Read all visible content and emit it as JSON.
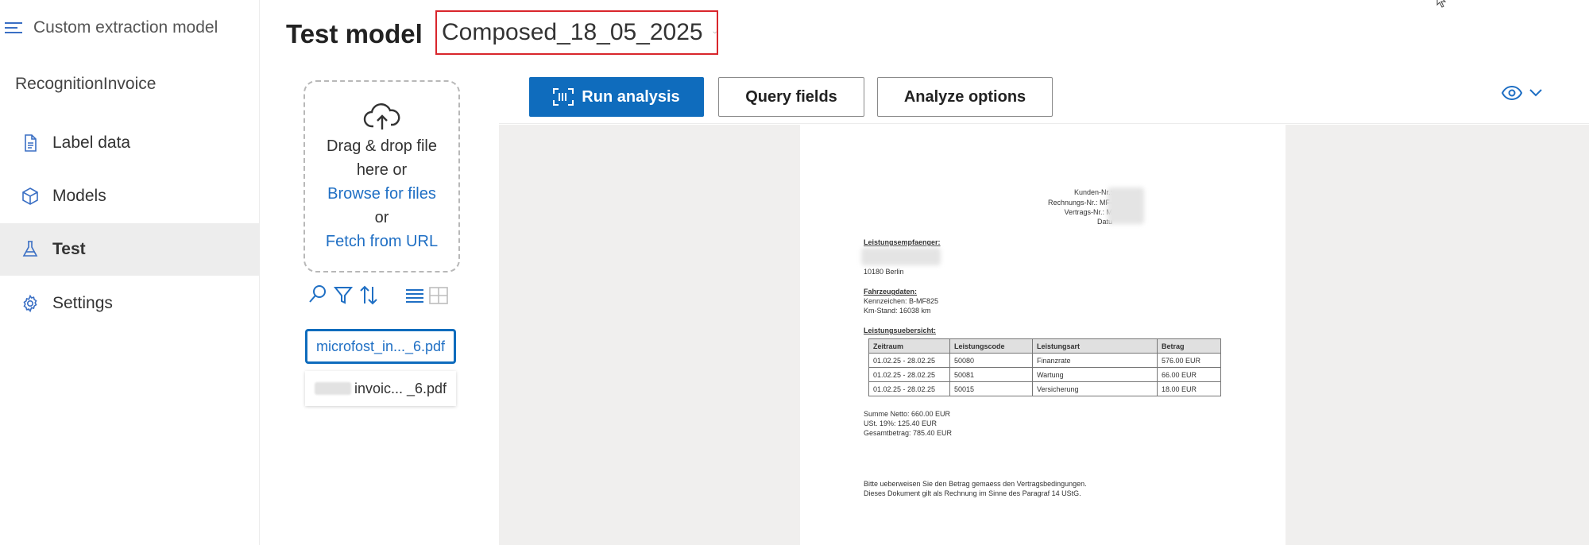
{
  "sidebar": {
    "app_title": "Custom extraction model",
    "project_name": "RecognitionInvoice",
    "items": [
      {
        "label": "Label data",
        "icon": "document-icon"
      },
      {
        "label": "Models",
        "icon": "cube-icon"
      },
      {
        "label": "Test",
        "icon": "flask-icon",
        "active": true
      },
      {
        "label": "Settings",
        "icon": "gear-icon"
      }
    ]
  },
  "header": {
    "title": "Test model",
    "selected_model": "Composed_18_05_2025"
  },
  "upload": {
    "line1": "Drag & drop file",
    "line2": "here or",
    "browse": "Browse for files",
    "or": "or",
    "fetch": "Fetch from URL"
  },
  "files": [
    {
      "name": "microfost_in..._6.pdf",
      "selected": true
    },
    {
      "name_visible": "invoic... _6.pdf",
      "selected": false
    }
  ],
  "toolbar": {
    "run_label": "Run analysis",
    "query_label": "Query fields",
    "options_label": "Analyze options"
  },
  "document": {
    "header_fields": [
      "Kunden-Nr.:",
      "Rechnungs-Nr.: MF-",
      "Vertrags-Nr.: M",
      "Datu"
    ],
    "recipient_title": "Leistungsempfaenger:",
    "recipient_city": "10180 Berlin",
    "vehicle_title": "Fahrzeugdaten:",
    "vehicle_plate": "Kennzeichen: B-MF825",
    "vehicle_km": "Km-Stand: 16038 km",
    "overview_title": "Leistungsuebersicht:",
    "table": {
      "headers": [
        "Zeitraum",
        "Leistungscode",
        "Leistungsart",
        "Betrag"
      ],
      "rows": [
        [
          "01.02.25 - 28.02.25",
          "50080",
          "Finanzrate",
          "576.00 EUR"
        ],
        [
          "01.02.25 - 28.02.25",
          "50081",
          "Wartung",
          "66.00 EUR"
        ],
        [
          "01.02.25 - 28.02.25",
          "50015",
          "Versicherung",
          "18.00 EUR"
        ]
      ]
    },
    "sum_net": "Summe Netto: 660.00 EUR",
    "tax": "USt. 19%: 125.40 EUR",
    "total": "Gesamtbetrag: 785.40 EUR",
    "footer1": "Bitte ueberweisen Sie den Betrag gemaess den Vertragsbedingungen.",
    "footer2": "Dieses Dokument gilt als Rechnung im Sinne des Paragraf 14 UStG."
  },
  "colors": {
    "accent": "#0f6cbd",
    "highlight_border": "#d9262c",
    "canvas_bg": "#f0efee",
    "active_nav_bg": "#ededed"
  }
}
